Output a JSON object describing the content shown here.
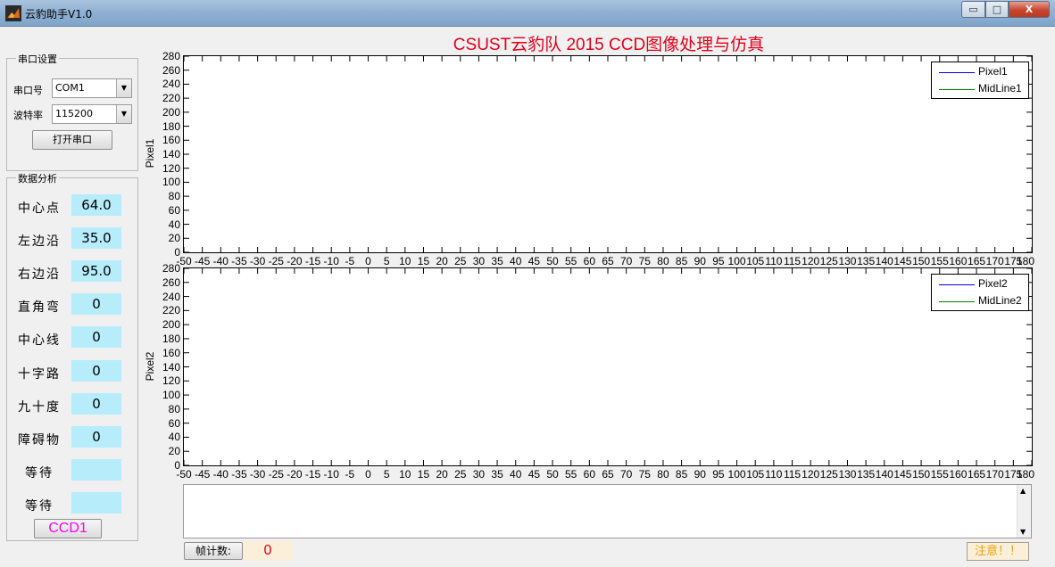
{
  "window": {
    "title": "云豹助手V1.0",
    "min_glyph": "▭",
    "max_glyph": "□",
    "close_glyph": "X"
  },
  "serial": {
    "group_title": "串口设置",
    "port_label": "串口号",
    "port_value": "COM1",
    "baud_label": "波特率",
    "baud_value": "115200",
    "open_button": "打开串口"
  },
  "analysis": {
    "group_title": "数据分析",
    "metrics": [
      {
        "label": "中心点",
        "value": "64.0"
      },
      {
        "label": "左边沿",
        "value": "35.0"
      },
      {
        "label": "右边沿",
        "value": "95.0"
      },
      {
        "label": "直角弯",
        "value": "0"
      },
      {
        "label": "中心线",
        "value": "0"
      },
      {
        "label": "十字路",
        "value": "0"
      },
      {
        "label": "九十度",
        "value": "0"
      },
      {
        "label": "障碍物",
        "value": "0"
      },
      {
        "label": "等待",
        "value": ""
      },
      {
        "label": "等待",
        "value": ""
      }
    ],
    "ccd_button": "CCD1"
  },
  "plot": {
    "title": "CSUST云豹队 2015 CCD图像处理与仿真"
  },
  "chart_data": [
    {
      "type": "line",
      "ylabel": "Pixel1",
      "xlim": [
        -50,
        180
      ],
      "ylim": [
        0,
        280
      ],
      "xticks": [
        -50,
        -45,
        -40,
        -35,
        -30,
        -25,
        -20,
        -15,
        -10,
        -5,
        0,
        5,
        10,
        15,
        20,
        25,
        30,
        35,
        40,
        45,
        50,
        55,
        60,
        65,
        70,
        75,
        80,
        85,
        90,
        95,
        100,
        105,
        110,
        115,
        120,
        125,
        130,
        135,
        140,
        145,
        150,
        155,
        160,
        165,
        170,
        175,
        180
      ],
      "yticks": [
        0,
        20,
        40,
        60,
        80,
        100,
        120,
        140,
        160,
        180,
        200,
        220,
        240,
        260,
        280
      ],
      "legend_position": "top-right",
      "series": [
        {
          "name": "Pixel1",
          "color": "#0000ff",
          "values": []
        },
        {
          "name": "MidLine1",
          "color": "#008000",
          "values": []
        }
      ]
    },
    {
      "type": "line",
      "ylabel": "Pixel2",
      "xlim": [
        -50,
        180
      ],
      "ylim": [
        0,
        280
      ],
      "xticks": [
        -50,
        -45,
        -40,
        -35,
        -30,
        -25,
        -20,
        -15,
        -10,
        -5,
        0,
        5,
        10,
        15,
        20,
        25,
        30,
        35,
        40,
        45,
        50,
        55,
        60,
        65,
        70,
        75,
        80,
        85,
        90,
        95,
        100,
        105,
        110,
        115,
        120,
        125,
        130,
        135,
        140,
        145,
        150,
        155,
        160,
        165,
        170,
        175,
        180
      ],
      "yticks": [
        0,
        20,
        40,
        60,
        80,
        100,
        120,
        140,
        160,
        180,
        200,
        220,
        240,
        260,
        280
      ],
      "legend_position": "top-right",
      "series": [
        {
          "name": "Pixel2",
          "color": "#0000ff",
          "values": []
        },
        {
          "name": "MidLine2",
          "color": "#008000",
          "values": []
        }
      ]
    }
  ],
  "status": {
    "frame_count_label": "帧计数:",
    "frame_count_value": "0",
    "warning_button": "注意！！"
  }
}
